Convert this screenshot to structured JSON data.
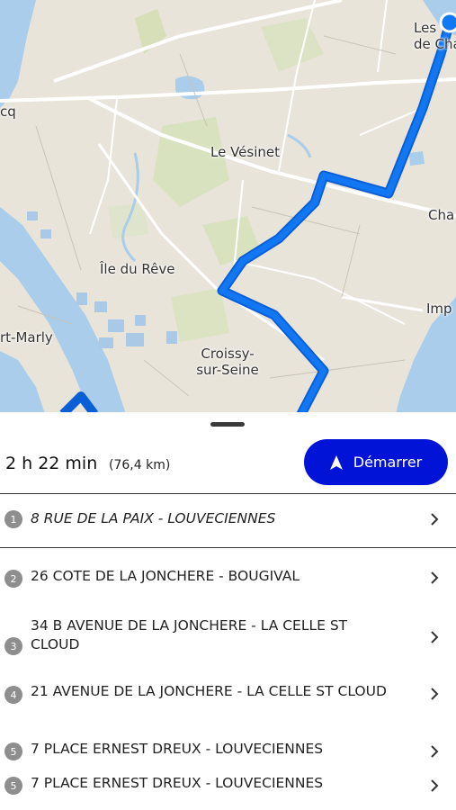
{
  "map": {
    "labels": [
      {
        "id": "les-chatou",
        "line1": "Les",
        "line2": "de Cha"
      },
      {
        "id": "le-vesinet",
        "text": "Le Vésinet"
      },
      {
        "id": "ile-du-reve",
        "text": "Île du Rêve"
      },
      {
        "id": "croissy",
        "line1": "Croissy-",
        "line2": "sur-Seine"
      },
      {
        "id": "port-marly",
        "text": "rt-Marly"
      },
      {
        "id": "cq",
        "text": "cq"
      },
      {
        "id": "cha",
        "text": "Cha"
      },
      {
        "id": "imp",
        "text": "Imp"
      }
    ]
  },
  "summary": {
    "duration": "2 h 22 min",
    "distance": "(76,4 km)",
    "start_label": "Démarrer"
  },
  "colors": {
    "accent": "#0013d6",
    "route": "#0a66e8",
    "badge": "#8e8e8e"
  },
  "stops": [
    {
      "number": "1",
      "address": "8 RUE DE LA PAIX - LOUVECIENNES"
    },
    {
      "number": "2",
      "address": "26 COTE DE LA JONCHERE - BOUGIVAL"
    },
    {
      "number": "3",
      "address": "34 B AVENUE DE LA JONCHERE - LA CELLE ST CLOUD"
    },
    {
      "number": "4",
      "address": "21 AVENUE DE LA JONCHERE - LA CELLE ST CLOUD"
    },
    {
      "number": "5",
      "address": "7 PLACE ERNEST DREUX - LOUVECIENNES"
    },
    {
      "number": "5",
      "address": "7 PLACE ERNEST DREUX - LOUVECIENNES"
    }
  ]
}
